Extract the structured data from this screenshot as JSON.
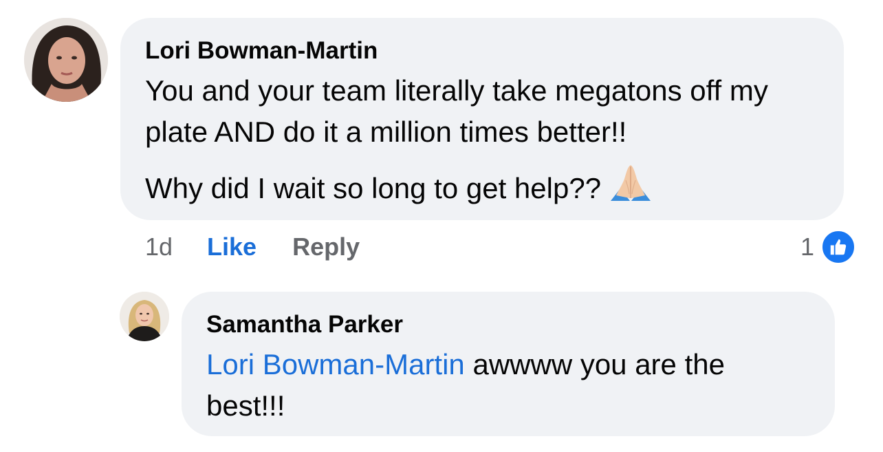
{
  "comments": [
    {
      "author": "Lori Bowman-Martin",
      "avatar_icon": "profile-photo",
      "paragraphs": [
        "You and your team literally take megatons off my plate AND do it a million times better!!",
        "Why did I wait so long to get help??"
      ],
      "emoji_icon": "folded-hands-icon",
      "time": "1d",
      "like_label": "Like",
      "reply_label": "Reply",
      "reaction_count": "1",
      "reaction_icon": "thumbs-up-icon"
    },
    {
      "author": "Samantha Parker",
      "avatar_icon": "profile-photo",
      "mention": "Lori Bowman-Martin",
      "text": " awwww you are the best!!!"
    }
  ],
  "colors": {
    "bubble": "#f0f2f5",
    "link": "#1a6ed8",
    "meta": "#65676b",
    "like_badge": "#1877f2"
  }
}
